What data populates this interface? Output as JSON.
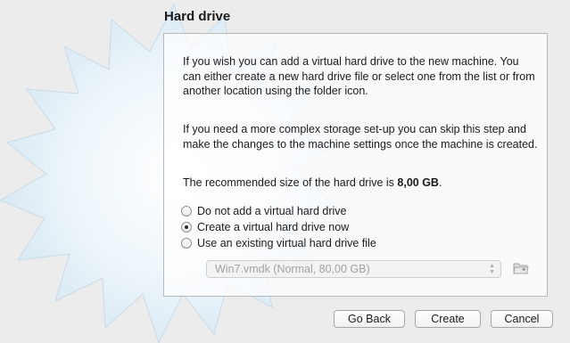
{
  "wizard": {
    "title": "Hard drive",
    "paragraph1": "If you wish you can add a virtual hard drive to the new machine. You can either create a new hard drive file or select one from the list or from another location using the folder icon.",
    "paragraph2": "If you need a more complex storage set-up you can skip this step and make the changes to the machine settings once the machine is created.",
    "paragraph3_prefix": "The recommended size of the hard drive is ",
    "recommended_size": "8,00 GB",
    "paragraph3_suffix": ".",
    "options": [
      {
        "label": "Do not add a virtual hard drive",
        "checked": false
      },
      {
        "label": "Create a virtual hard drive now",
        "checked": true
      },
      {
        "label": "Use an existing virtual hard drive file",
        "checked": false
      }
    ],
    "existing_file_select": {
      "value": "Win7.vmdk (Normal, 80,00 GB)",
      "disabled": true
    },
    "folder_icon": "folder-icon",
    "buttons": {
      "back": "Go Back",
      "create": "Create",
      "cancel": "Cancel"
    }
  }
}
